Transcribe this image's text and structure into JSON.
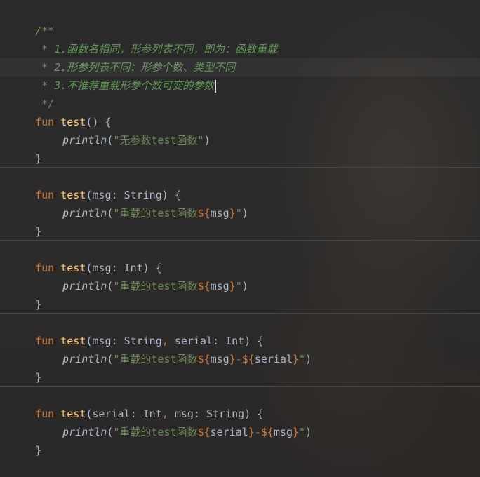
{
  "editor": {
    "doc_comment": {
      "open": "/**",
      "line1": " * 1.函数名相同，形参列表不同，即为：函数重载",
      "line2": " * 2.形参列表不同：形参个数、类型不同",
      "line3": " * 3.不推荐重载形参个数可变的参数",
      "close": " */"
    },
    "keyword_fun": "fun",
    "function_name": "test",
    "call_name": "println",
    "open_brace": "{",
    "close_brace": "}",
    "fn1": {
      "params": "()",
      "string_text": "无参数test函数"
    },
    "fn2": {
      "param_name": "msg",
      "param_type": "String",
      "string_text": "重载的test函数",
      "template_var": "msg"
    },
    "fn3": {
      "param_name": "msg",
      "param_type": "Int",
      "string_text": "重载的test函数",
      "template_var": "msg"
    },
    "fn4": {
      "param1_name": "msg",
      "param1_type": "String",
      "param2_name": "serial",
      "param2_type": "Int",
      "string_text": "重载的test函数",
      "template_var1": "msg",
      "template_var2": "serial"
    },
    "fn5": {
      "param1_name": "serial",
      "param1_type": "Int",
      "param2_name": "msg",
      "param2_type": "String",
      "string_text": "重载的test函数",
      "template_var1": "serial",
      "template_var2": "msg"
    }
  },
  "colors": {
    "background": "#2b2b2b",
    "keyword": "#cc7832",
    "function": "#ffc66d",
    "string": "#6a8759",
    "doc_comment": "#629755",
    "default_text": "#a9b7c6"
  }
}
